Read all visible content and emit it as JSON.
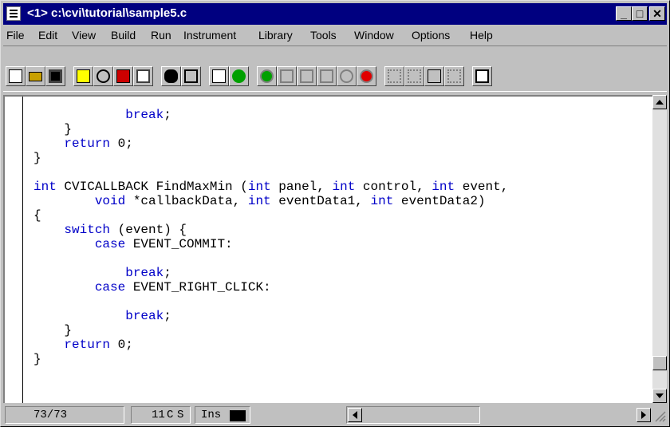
{
  "window": {
    "title": "<1> c:\\cvi\\tutorial\\sample5.c"
  },
  "caption_buttons": {
    "minimize": "_",
    "maximize": "□",
    "close": "✕"
  },
  "menu": [
    "File",
    "Edit",
    "View",
    "Build",
    "Run",
    "Instrument",
    "Library",
    "Tools",
    "Window",
    "Options",
    "Help"
  ],
  "toolbar": [
    "new-file",
    "open-folder",
    "save-disk",
    "compile",
    "go-to-definition",
    "tag",
    "function-panel",
    "find-binoculars",
    "find-replace",
    "run-list",
    "run-figure",
    "breakpoint-toggle",
    "step-into",
    "step-over",
    "step-out",
    "continue",
    "stop",
    "watch-variables",
    "view-variables",
    "edit-variable",
    "find-function",
    "window-list"
  ],
  "code_lines": [
    [
      [
        "",
        "            "
      ],
      [
        "kw",
        "break"
      ],
      [
        "",
        ";"
      ]
    ],
    [
      [
        "",
        "    }"
      ]
    ],
    [
      [
        "",
        "    "
      ],
      [
        "kw",
        "return"
      ],
      [
        "",
        " 0;"
      ]
    ],
    [
      [
        "",
        "}"
      ]
    ],
    [
      [
        "",
        ""
      ]
    ],
    [
      [
        "kw",
        "int"
      ],
      [
        "",
        " CVICALLBACK FindMaxMin ("
      ],
      [
        "kw",
        "int"
      ],
      [
        "",
        " panel, "
      ],
      [
        "kw",
        "int"
      ],
      [
        "",
        " control, "
      ],
      [
        "kw",
        "int"
      ],
      [
        "",
        " event,"
      ]
    ],
    [
      [
        "",
        "        "
      ],
      [
        "kw",
        "void"
      ],
      [
        "",
        " *callbackData, "
      ],
      [
        "kw",
        "int"
      ],
      [
        "",
        " eventData1, "
      ],
      [
        "kw",
        "int"
      ],
      [
        "",
        " eventData2)"
      ]
    ],
    [
      [
        "",
        "{"
      ]
    ],
    [
      [
        "",
        "    "
      ],
      [
        "kw",
        "switch"
      ],
      [
        "",
        " (event) {"
      ]
    ],
    [
      [
        "",
        "        "
      ],
      [
        "kw",
        "case"
      ],
      [
        "",
        " EVENT_COMMIT:"
      ]
    ],
    [
      [
        "",
        ""
      ]
    ],
    [
      [
        "",
        "            "
      ],
      [
        "kw",
        "break"
      ],
      [
        "",
        ";"
      ]
    ],
    [
      [
        "",
        "        "
      ],
      [
        "kw",
        "case"
      ],
      [
        "",
        " EVENT_RIGHT_CLICK:"
      ]
    ],
    [
      [
        "",
        ""
      ]
    ],
    [
      [
        "",
        "            "
      ],
      [
        "kw",
        "break"
      ],
      [
        "",
        ";"
      ]
    ],
    [
      [
        "",
        "    }"
      ]
    ],
    [
      [
        "",
        "    "
      ],
      [
        "kw",
        "return"
      ],
      [
        "",
        " 0;"
      ]
    ],
    [
      [
        "",
        "}"
      ]
    ]
  ],
  "status": {
    "line_position": "73/73",
    "column": "11",
    "c_flag": "C",
    "s_flag": "S",
    "insert_mode": "Ins"
  },
  "colors": {
    "keyword": "#0000c8",
    "titlebar": "#000080",
    "face": "#c0c0c0"
  }
}
